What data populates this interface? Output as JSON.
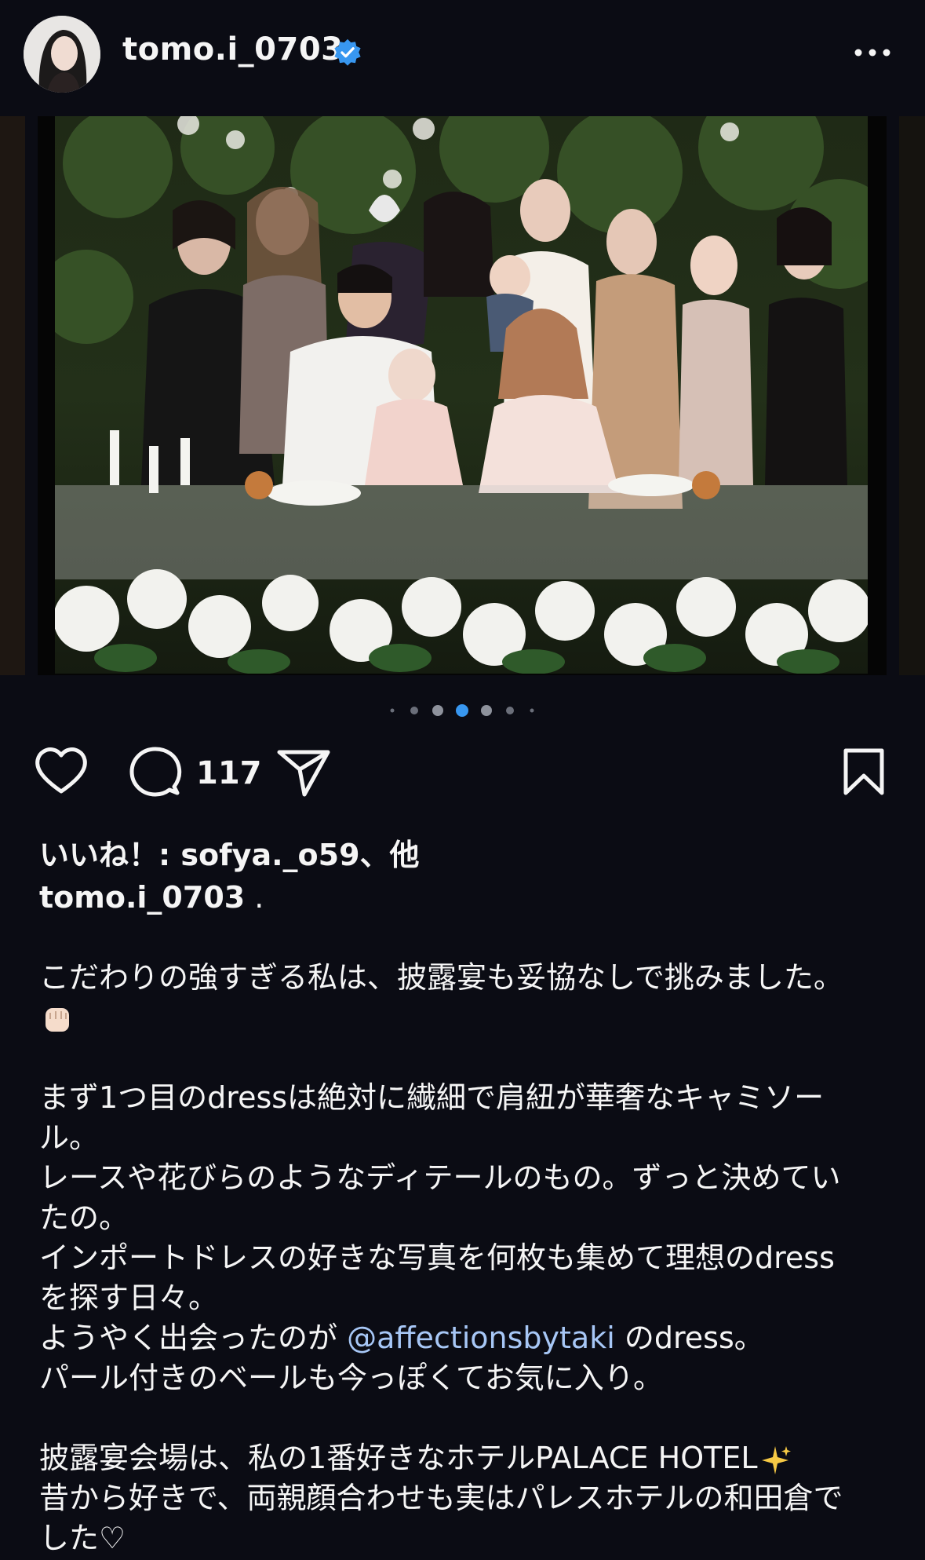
{
  "post": {
    "username": "tomo.i_0703",
    "comment_count": "117",
    "carousel_dots": 7,
    "active_dot": 3
  },
  "likes": {
    "text": "いいね！: sofya._o59、他"
  },
  "caption": {
    "username": "tomo.i_0703",
    "first": ".",
    "line1": "こだわりの強すぎる私は、披露宴も妥協なしで挑みました。",
    "p2_l1": "まず1つ目のdressは絶対に繊細で肩紐が華奢なキャミソー",
    "p2_l2": "ル。",
    "p2_l3": "レースや花びらのようなディテールのもの。ずっと決めてい",
    "p2_l4": "たの。",
    "p2_l5": "インポートドレスの好きな写真を何枚も集めて理想のdress",
    "p2_l6": "を探す日々。",
    "p2_l7_prefix": "ようやく出会ったのが ",
    "p2_l7_mention": "@affectionsbytaki",
    "p2_l7_suffix": " のdress。",
    "p2_l8": "パール付きのベールも今っぽくてお気に入り。",
    "p3_l1": "披露宴会場は、私の1番好きなホテルPALACE HOTEL",
    "p3_l2": "昔から好きで、両親顔合わせも実はパレスホテルの和田倉で",
    "p3_l3": "した♡"
  },
  "icons": {
    "verified": "verified-badge-icon",
    "more": "more-options-icon",
    "like": "heart-icon",
    "comment": "comment-icon",
    "share": "send-icon",
    "save": "bookmark-icon",
    "fist": "raised-fist-emoji",
    "sparkles": "sparkles-emoji"
  },
  "colors": {
    "background": "#0b0c14",
    "verified": "#3897f0",
    "active_dot": "#3897f0",
    "mention": "#a7c7f6"
  }
}
